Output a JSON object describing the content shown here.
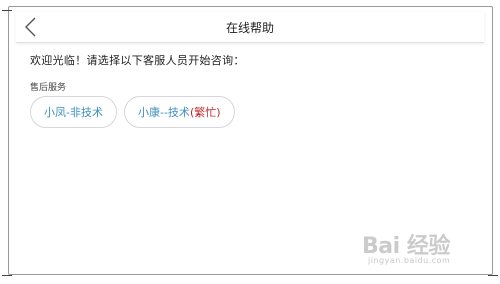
{
  "header": {
    "title": "在线帮助",
    "back_icon": "chevron-left-icon"
  },
  "welcome_text": "欢迎光临！请选择以下客服人员开始咨询：",
  "section": {
    "label": "售后服务"
  },
  "agents": [
    {
      "label": "小凤-非技术",
      "status": ""
    },
    {
      "label": "小康--技术",
      "status": "(繁忙)"
    }
  ],
  "colors": {
    "agent_text": "#3b8fbf",
    "busy_text": "#c0282d",
    "header_border": "#e2e2e2"
  },
  "watermark": {
    "logo": "Bai 经验",
    "url": "jingyan.baidu.com"
  }
}
